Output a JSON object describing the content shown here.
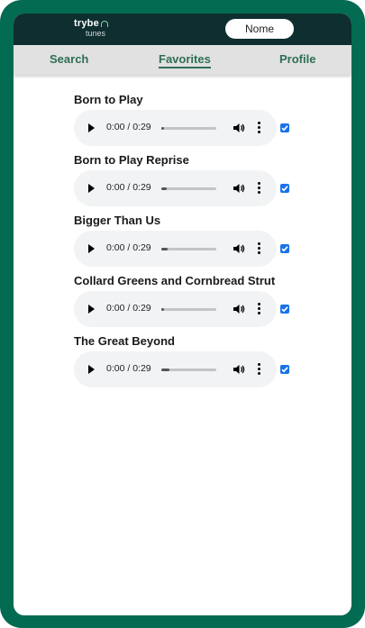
{
  "header": {
    "logo_top": "trybe",
    "logo_sub": "tunes",
    "user_name": "Nome"
  },
  "nav": {
    "search": "Search",
    "favorites": "Favorites",
    "profile": "Profile",
    "active": "favorites"
  },
  "songs": [
    {
      "title": "Born to Play",
      "time": "0:00 / 0:29",
      "favorite": true,
      "buffered": 0.05
    },
    {
      "title": "Born to Play Reprise",
      "time": "0:00 / 0:29",
      "favorite": true,
      "buffered": 0.1
    },
    {
      "title": "Bigger Than Us",
      "time": "0:00 / 0:29",
      "favorite": true,
      "buffered": 0.12
    },
    {
      "title": "Collard Greens and Cornbread Strut",
      "time": "0:00 / 0:29",
      "favorite": true,
      "buffered": 0.05
    },
    {
      "title": "The Great Beyond",
      "time": "0:00 / 0:29",
      "favorite": true,
      "buffered": 0.15
    }
  ],
  "colors": {
    "frame": "#036b52",
    "header_bg": "#0f2e30",
    "nav_text": "#2e6f55",
    "checkbox": "#1a73e8"
  }
}
